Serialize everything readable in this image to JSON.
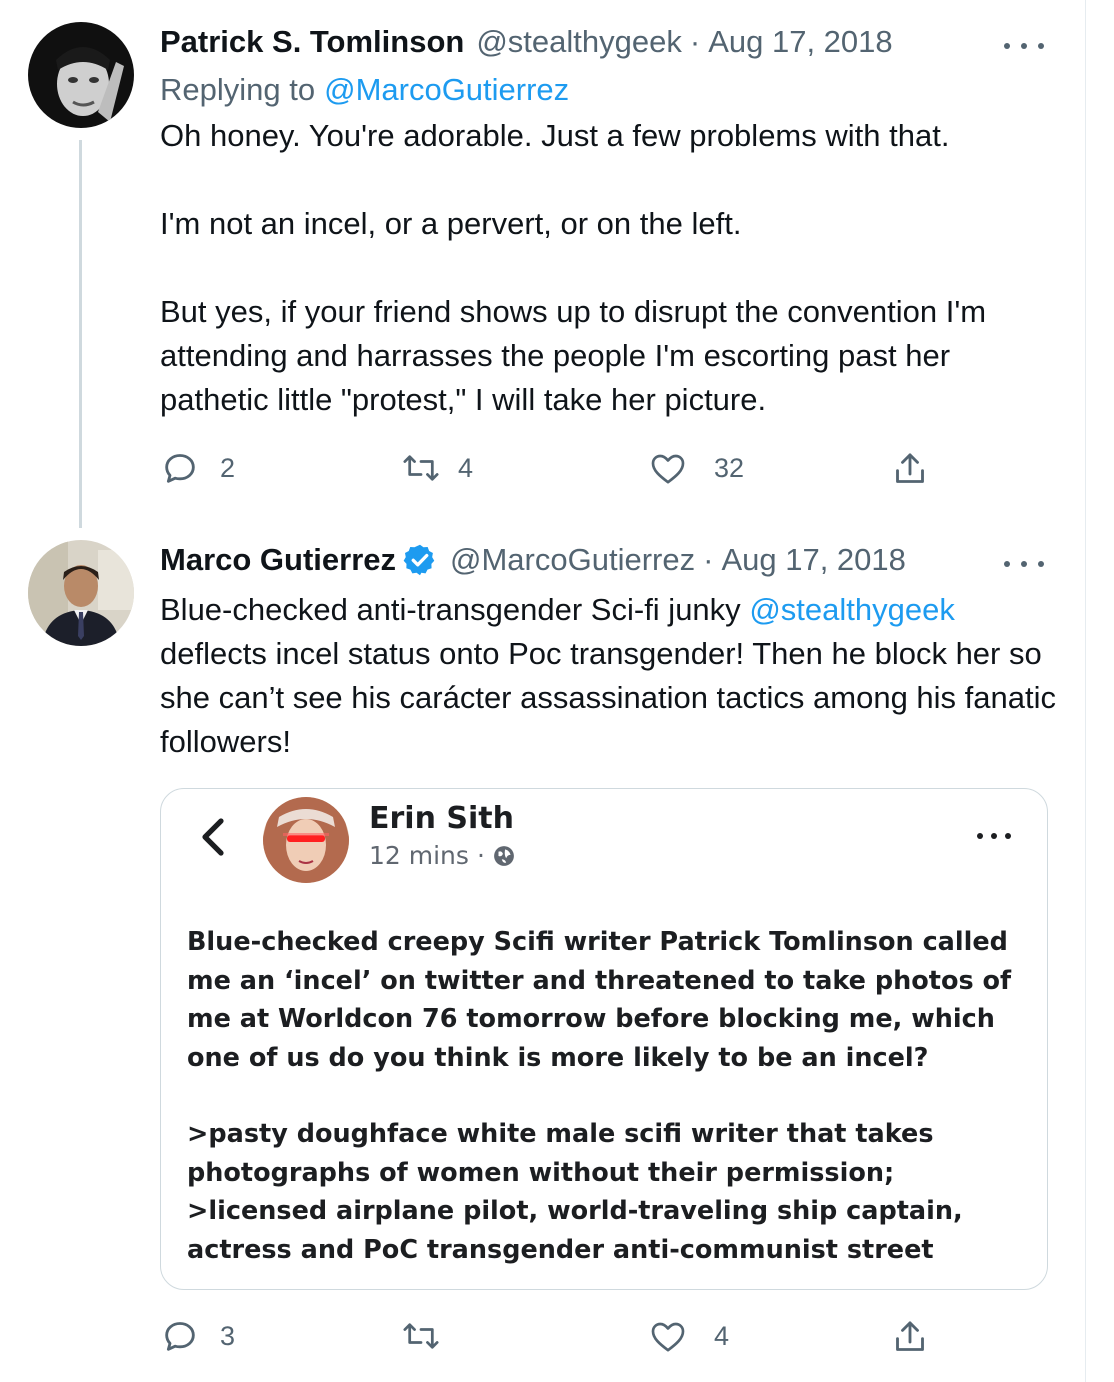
{
  "tweet1": {
    "name": "Patrick S. Tomlinson",
    "handle": "@stealthygeek",
    "separator": "·",
    "date": "Aug 17, 2018",
    "replying_prefix": "Replying to",
    "replying_to": "@MarcoGutierrez",
    "paragraphs": [
      "Oh honey. You're adorable. Just a few problems with that.",
      "I'm not an incel, or a pervert, or on the left.",
      "But yes, if your friend shows up to disrupt the convention I'm attending and harrasses the people I'm escorting past her pathetic little \"protest,\" I will take her picture."
    ],
    "counts": {
      "replies": "2",
      "retweets": "4",
      "likes": "32"
    }
  },
  "tweet2": {
    "name": "Marco Gutierrez",
    "handle": "@MarcoGutierrez",
    "separator": "·",
    "date": "Aug 17, 2018",
    "text_before_mention": "Blue-checked anti-transgender Sci-fi junky",
    "mention": "@stealthygeek",
    "text_after_mention": "deflects incel status onto Poc transgender! Then he block her so she can’t see his carácter assassination tactics among his fanatic followers!",
    "counts": {
      "replies": "3",
      "retweets": "",
      "likes": "4"
    }
  },
  "quoted_post": {
    "name": "Erin Sith",
    "time": "12 mins",
    "separator": "·",
    "paragraphs": [
      "Blue-checked creepy Scifi writer Patrick Tomlinson called me an ‘incel’ on twitter and threatened to take photos of me at Worldcon 76 tomorrow before blocking me, which one of us do you think is more likely to be an incel?",
      ">pasty doughface white male scifi writer that takes photographs of women without their permission;\n>licensed airplane pilot, world-traveling ship captain, actress and PoC transgender anti-communist street"
    ]
  },
  "colors": {
    "link": "#1d9bf0",
    "verified": "#1d9bf0",
    "muted": "#536471",
    "border": "#cfd9de"
  },
  "icons": [
    "reply-icon",
    "retweet-icon",
    "like-icon",
    "share-icon",
    "more-icon",
    "verified-badge-icon",
    "back-chevron-icon",
    "globe-icon"
  ]
}
